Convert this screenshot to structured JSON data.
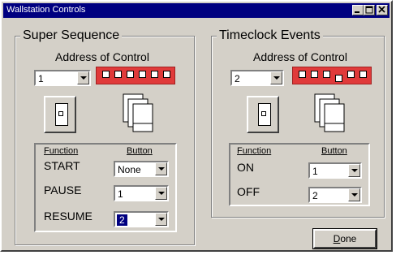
{
  "window": {
    "title": "Wallstation Controls"
  },
  "left_group": {
    "title": "Super Sequence",
    "address_label": "Address of Control",
    "address_value": "1",
    "header_function": "Function",
    "header_button": "Button",
    "rows": [
      {
        "function": "START",
        "button": "None"
      },
      {
        "function": "PAUSE",
        "button": "1"
      },
      {
        "function": "RESUME",
        "button": "2"
      }
    ]
  },
  "right_group": {
    "title": "Timeclock Events",
    "address_label": "Address of Control",
    "address_value": "2",
    "header_function": "Function",
    "header_button": "Button",
    "rows": [
      {
        "function": "ON",
        "button": "1"
      },
      {
        "function": "OFF",
        "button": "2"
      }
    ]
  },
  "done_button": {
    "label": "Done",
    "accesskey": "D"
  },
  "colors": {
    "titlebar": "#000080",
    "dip_switch": "#e03a3a",
    "face": "#d4d0c8"
  }
}
